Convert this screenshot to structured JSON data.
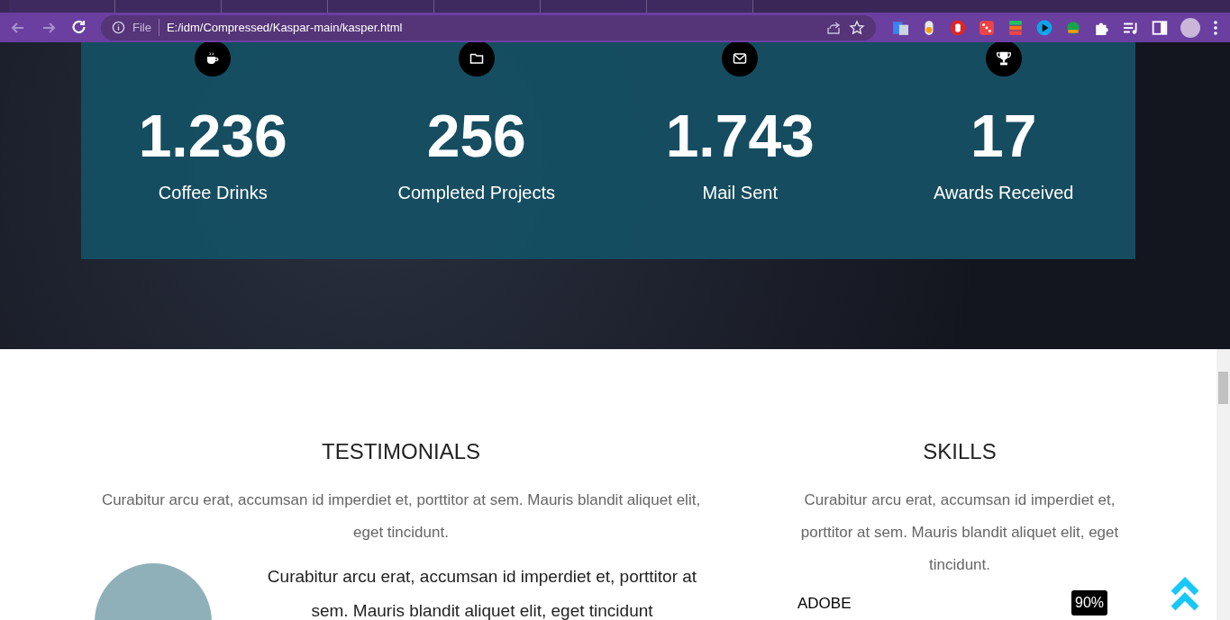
{
  "address_bar": {
    "scheme": "File",
    "url": "E:/idm/Compressed/Kaspar-main/kasper.html"
  },
  "stats": [
    {
      "kind": "coffee",
      "value": "1.236",
      "label": "Coffee Drinks"
    },
    {
      "kind": "folder",
      "value": "256",
      "label": "Completed Projects"
    },
    {
      "kind": "mail",
      "value": "1.743",
      "label": "Mail Sent"
    },
    {
      "kind": "trophy",
      "value": "17",
      "label": "Awards Received"
    }
  ],
  "testimonials": {
    "title": "TESTIMONIALS",
    "intro": "Curabitur arcu erat, accumsan id imperdiet et, porttitor at sem. Mauris blandit aliquet elit, eget tincidunt.",
    "quote": "Curabitur arcu erat, accumsan id imperdiet et, porttitor at sem. Mauris blandit aliquet elit, eget tincidunt"
  },
  "skills": {
    "title": "SKILLS",
    "intro": "Curabitur arcu erat, accumsan id imperdiet et, porttitor at sem. Mauris blandit aliquet elit, eget tincidunt.",
    "items": [
      {
        "name": "ADOBE",
        "reading": "90%",
        "level": 0.9
      }
    ]
  }
}
